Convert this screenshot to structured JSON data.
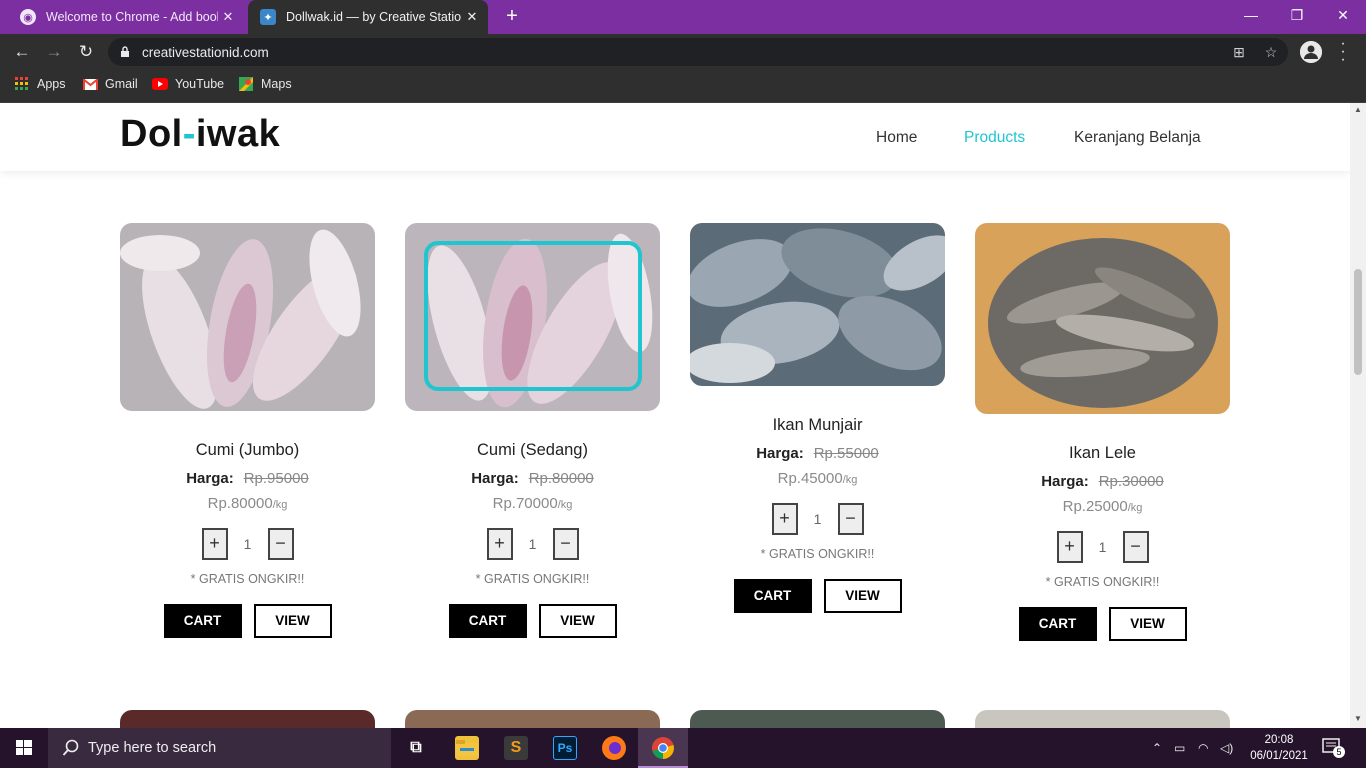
{
  "browser": {
    "tabs": [
      {
        "title": "Welcome to Chrome - Add book",
        "active": false
      },
      {
        "title": "Dollwak.id — by Creative Station",
        "active": true
      }
    ],
    "url": "creativestationid.com",
    "bookmarks": [
      {
        "label": "Apps",
        "icon": "apps-grid-icon"
      },
      {
        "label": "Gmail",
        "icon": "gmail-icon"
      },
      {
        "label": "YouTube",
        "icon": "youtube-icon"
      },
      {
        "label": "Maps",
        "icon": "maps-icon"
      }
    ]
  },
  "site": {
    "logo": {
      "part1": "Dol",
      "dash": "-",
      "part2": "iwak"
    },
    "nav": [
      {
        "label": "Home",
        "active": false
      },
      {
        "label": "Products",
        "active": true
      },
      {
        "label": "Keranjang Belanja",
        "active": false
      }
    ],
    "accent_color": "#20c5cf",
    "price_label": "Harga:",
    "unit": "/kg",
    "shipping_note": "* GRATIS ONGKIR!!",
    "cart_label": "CART",
    "view_label": "VIEW",
    "products": [
      {
        "name": "Cumi (Jumbo)",
        "old_price": "Rp.95000",
        "price": "Rp.80000",
        "qty": "1"
      },
      {
        "name": "Cumi (Sedang)",
        "old_price": "Rp.80000",
        "price": "Rp.70000",
        "qty": "1"
      },
      {
        "name": "Ikan Munjair",
        "old_price": "Rp.55000",
        "price": "Rp.45000",
        "qty": "1"
      },
      {
        "name": "Ikan Lele",
        "old_price": "Rp.30000",
        "price": "Rp.25000",
        "qty": "1"
      }
    ]
  },
  "taskbar": {
    "search_placeholder": "Type here to search",
    "time": "20:08",
    "date": "06/01/2021",
    "notification_count": "5"
  }
}
